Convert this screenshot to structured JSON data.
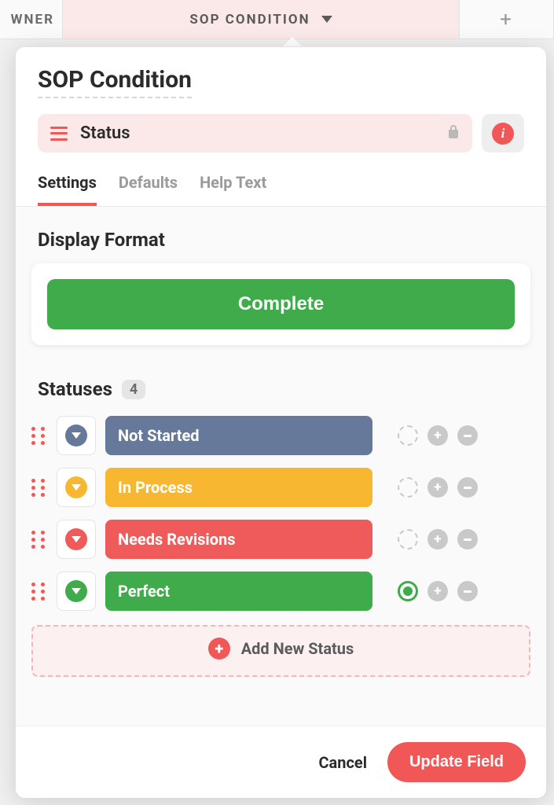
{
  "columns": {
    "owner": "WNER",
    "sop": "SOP CONDITION",
    "plus": "+"
  },
  "panel": {
    "title": "SOP Condition",
    "field_type": "Status"
  },
  "tabs": [
    {
      "label": "Settings",
      "active": true
    },
    {
      "label": "Defaults",
      "active": false
    },
    {
      "label": "Help Text",
      "active": false
    }
  ],
  "display_format": {
    "heading": "Display Format",
    "button": "Complete"
  },
  "statuses": {
    "heading": "Statuses",
    "count": "4",
    "items": [
      {
        "label": "Not Started",
        "color": "#66799a",
        "default": false
      },
      {
        "label": "In Process",
        "color": "#f7b731",
        "default": false
      },
      {
        "label": "Needs Revisions",
        "color": "#ef5b5b",
        "default": false
      },
      {
        "label": "Perfect",
        "color": "#3fab4a",
        "default": true
      }
    ],
    "add_label": "Add New Status"
  },
  "footer": {
    "cancel": "Cancel",
    "update": "Update Field"
  }
}
